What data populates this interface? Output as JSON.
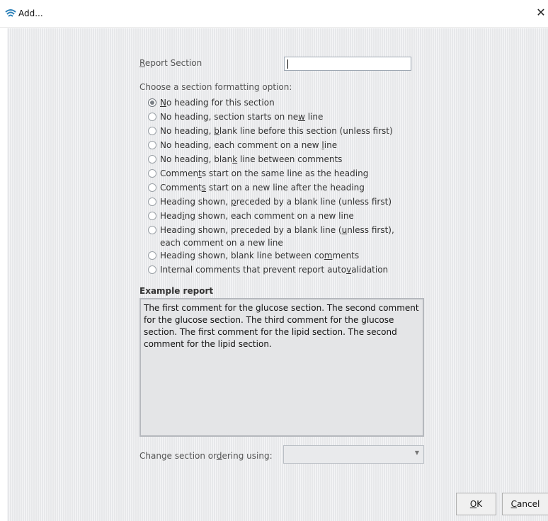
{
  "window": {
    "title": "Add..."
  },
  "form": {
    "report_section": {
      "label": "Report Section",
      "value": ""
    },
    "format_prompt": "Choose a section formatting option:",
    "options": [
      {
        "label": "No heading for this section",
        "checked": true
      },
      {
        "label": "No heading, section starts on new line",
        "checked": false
      },
      {
        "label": "No heading, blank line before this section (unless first)",
        "checked": false
      },
      {
        "label": "No heading, each comment on a new line",
        "checked": false
      },
      {
        "label": "No heading, blank line between comments",
        "checked": false
      },
      {
        "label": "Comments start on the same line as the heading",
        "checked": false
      },
      {
        "label": "Comments start on a new line after the heading",
        "checked": false
      },
      {
        "label": "Heading shown, preceded by a blank line (unless first)",
        "checked": false
      },
      {
        "label": "Heading shown, each comment on a new line",
        "checked": false
      },
      {
        "label_line1": "Heading shown, preceded by a blank line (unless first),",
        "label_line2": "each comment on a new line",
        "checked": false
      },
      {
        "label": "Heading shown, blank line between comments",
        "checked": false
      },
      {
        "label": "Internal comments that prevent report autovalidation",
        "checked": false
      }
    ],
    "example": {
      "label": "Example report",
      "text": "The first comment for the glucose section. The second comment for the glucose section. The third comment for the glucose section. The first comment for the lipid section. The second comment for the lipid section."
    },
    "ordering": {
      "label": "Change section ordering using:",
      "value": ""
    }
  },
  "buttons": {
    "ok": "OK",
    "cancel": "Cancel"
  },
  "icons": {
    "app": "app-logo-icon",
    "close": "close-icon"
  }
}
